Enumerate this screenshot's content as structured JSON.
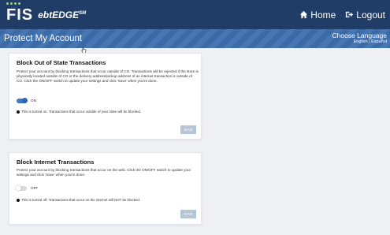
{
  "header": {
    "logo_text": "FIS",
    "product_name": "ebtEDGE",
    "product_mark": "SM",
    "home_label": "Home",
    "logout_label": "Logout"
  },
  "title_bar": {
    "title": "Protect My Account",
    "language_title": "Choose Language",
    "language_options": "English | Español"
  },
  "cards": [
    {
      "title": "Block Out of State Transactions",
      "description": "Protect your account by blocking transactions that occur outside of CO. Transactions will be rejected if the store is physically located outside of CO or the delivery address/pickup address of an internet transaction is outside of CO. Click the ON/OFF switch to update your settings and click 'Save' when you're done.",
      "toggle_label": "ON",
      "toggle_state": "on",
      "status_text": "This is turned on. Transactions that occur outside of your state will be blocked.",
      "save_label": "SAVE"
    },
    {
      "title": "Block Internet Transactions",
      "description": "Protect your account by blocking transactions that occur on the web. Click the ON/OFF switch to update your settings and click 'Save' when you're done.",
      "toggle_label": "OFF",
      "toggle_state": "off",
      "status_text": "This is turned off. Transactions that occur on the internet will NOT be blocked.",
      "save_label": "SAVE"
    }
  ],
  "colors": {
    "header_bg": "#1f3d66",
    "title_bar_bg": "#4676b3",
    "toggle_on": "#3e78c4",
    "save_button": "#b7c5d6",
    "logo_accent": "#9fd36b"
  }
}
